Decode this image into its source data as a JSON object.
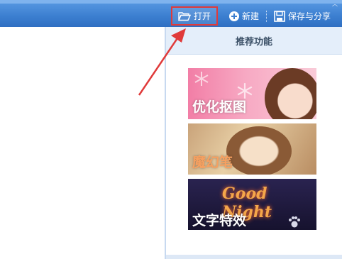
{
  "toolbar": {
    "open_label": "打开",
    "new_label": "新建",
    "save_label": "保存与分享"
  },
  "panel": {
    "title": "推荐功能",
    "cards": [
      {
        "label": "优化抠图"
      },
      {
        "label": "魔幻笔"
      },
      {
        "label": "文字特效",
        "subtitle": "Good Night"
      }
    ]
  },
  "colors": {
    "toolbar_blue": "#3c7fd0",
    "highlight_red": "#e03a3a",
    "panel_header_bg": "#e4eefa"
  }
}
